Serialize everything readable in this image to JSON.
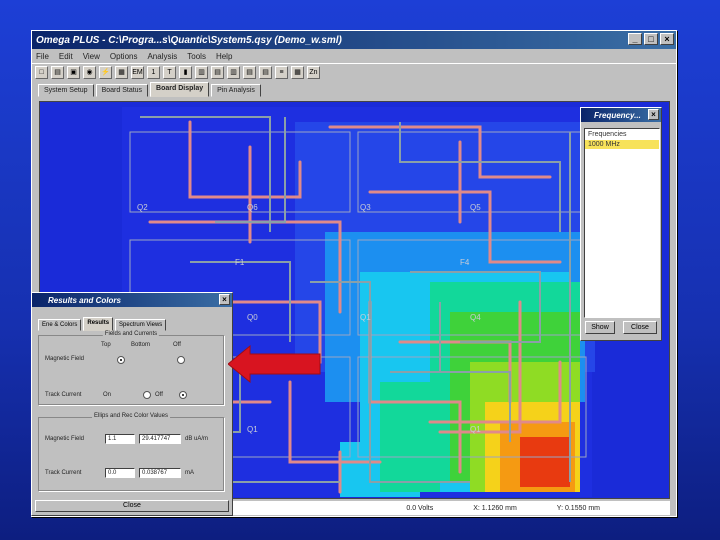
{
  "window": {
    "title": "Omega PLUS - C:\\Progra...s\\Quantic\\System5.qsy (Demo_w.sml)",
    "min": "_",
    "max": "□",
    "close": "×"
  },
  "menu": [
    "File",
    "Edit",
    "View",
    "Options",
    "Analysis",
    "Tools",
    "Help"
  ],
  "toolbar": [
    "□",
    "▤",
    "▣",
    "◉",
    "⚡",
    "▦",
    "EM",
    "1",
    "T",
    "▮",
    "▥",
    "▤",
    "▥",
    "▤",
    "▤",
    "≡",
    "▦",
    "Zn"
  ],
  "tabs": [
    "System Setup",
    "Board Status",
    "Board Display",
    "Pin Analysis"
  ],
  "board": {
    "labels": [
      "Q2",
      "Q6",
      "Q3",
      "Q5",
      "F1",
      "F4",
      "Q4",
      "Q0",
      "Q1",
      "Q4",
      "Q1",
      "Q1"
    ]
  },
  "status": {
    "a": "0.0 Volts",
    "b": "X: 1.1260 mm",
    "c": "Y: 0.1550 mm"
  },
  "frequency": {
    "title": "Frequency...",
    "close": "×",
    "header": "Frequencies",
    "selected": "1000 MHz",
    "show": "Show",
    "close_btn": "Close"
  },
  "results": {
    "title": "Results and Colors",
    "close": "×",
    "tabs": [
      "Ene & Colors",
      "Results",
      "Spectrum Views"
    ],
    "group1_title": "Fields and Currents",
    "col_top": "Top",
    "col_bottom": "Bottom",
    "col_off": "Off",
    "row1": "Magnetic Field",
    "row2": "Track Current",
    "row2_on": "On",
    "row2_off": "Off",
    "group2_title": "Ellips and Rec Color Values",
    "row3": "Magnetic Field",
    "row3_v1": "1.1",
    "row3_v2": "29.417747",
    "row3_unit": "dB uA/m",
    "row4": "Track Current",
    "row4_v1": "0.0",
    "row4_v2": "0.038767",
    "row4_unit": "mA",
    "close_btn": "Close"
  },
  "colors": {
    "titlebar": "#0a246a",
    "board_bg": "#1a2bd8",
    "trace": "#e08a8a",
    "arrow": "#d81420"
  }
}
